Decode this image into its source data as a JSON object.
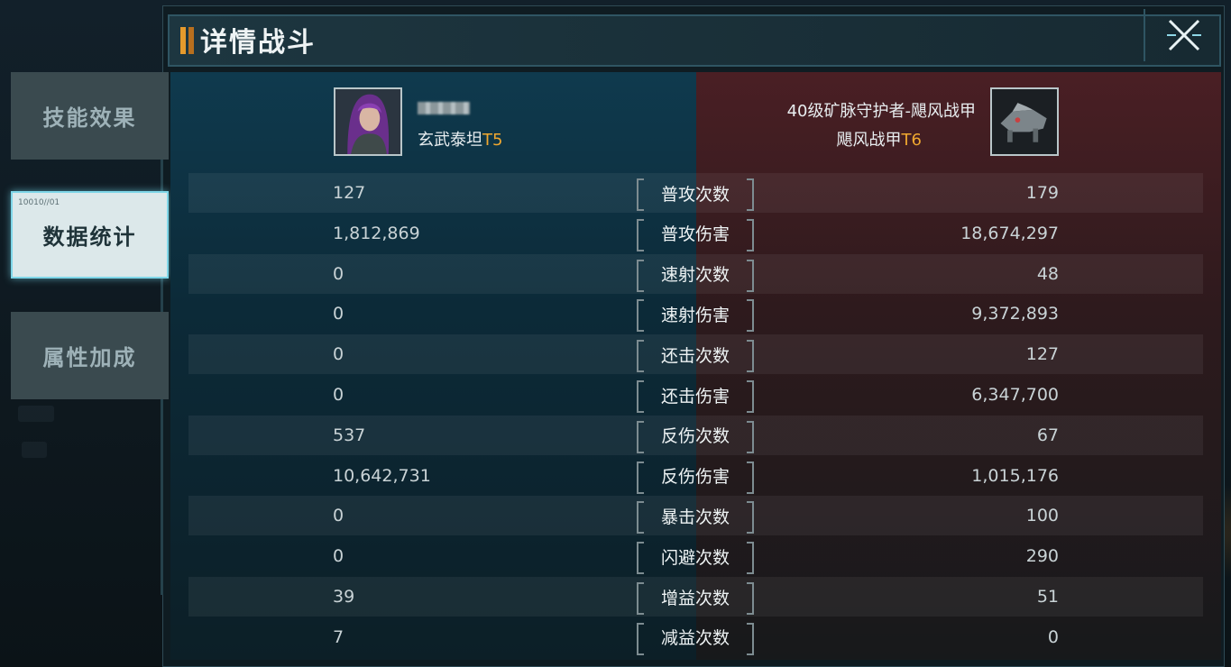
{
  "window": {
    "title": "详情战斗"
  },
  "sidebar": {
    "tabs": [
      {
        "label": "技能效果"
      },
      {
        "label": "数据统计",
        "code": "10010//01"
      },
      {
        "label": "属性加成"
      }
    ]
  },
  "left_player": {
    "name": "玄武泰坦",
    "tier": "T5"
  },
  "right_player": {
    "title": "40级矿脉守护者-飓风战甲",
    "name": "飓风战甲",
    "tier": "T6"
  },
  "stats": [
    {
      "label": "普攻次数",
      "left": "127",
      "right": "179"
    },
    {
      "label": "普攻伤害",
      "left": "1,812,869",
      "right": "18,674,297"
    },
    {
      "label": "速射次数",
      "left": "0",
      "right": "48"
    },
    {
      "label": "速射伤害",
      "left": "0",
      "right": "9,372,893"
    },
    {
      "label": "还击次数",
      "left": "0",
      "right": "127"
    },
    {
      "label": "还击伤害",
      "left": "0",
      "right": "6,347,700"
    },
    {
      "label": "反伤次数",
      "left": "537",
      "right": "67"
    },
    {
      "label": "反伤伤害",
      "left": "10,642,731",
      "right": "1,015,176"
    },
    {
      "label": "暴击次数",
      "left": "0",
      "right": "100"
    },
    {
      "label": "闪避次数",
      "left": "0",
      "right": "290"
    },
    {
      "label": "增益次数",
      "left": "39",
      "right": "51"
    },
    {
      "label": "减益次数",
      "left": "7",
      "right": "0"
    }
  ],
  "icons": {
    "close": "close-x-icon"
  },
  "colors": {
    "tier": "#f0a830",
    "accent": "#e59a2c",
    "selected_glow": "#7fd6e8"
  }
}
